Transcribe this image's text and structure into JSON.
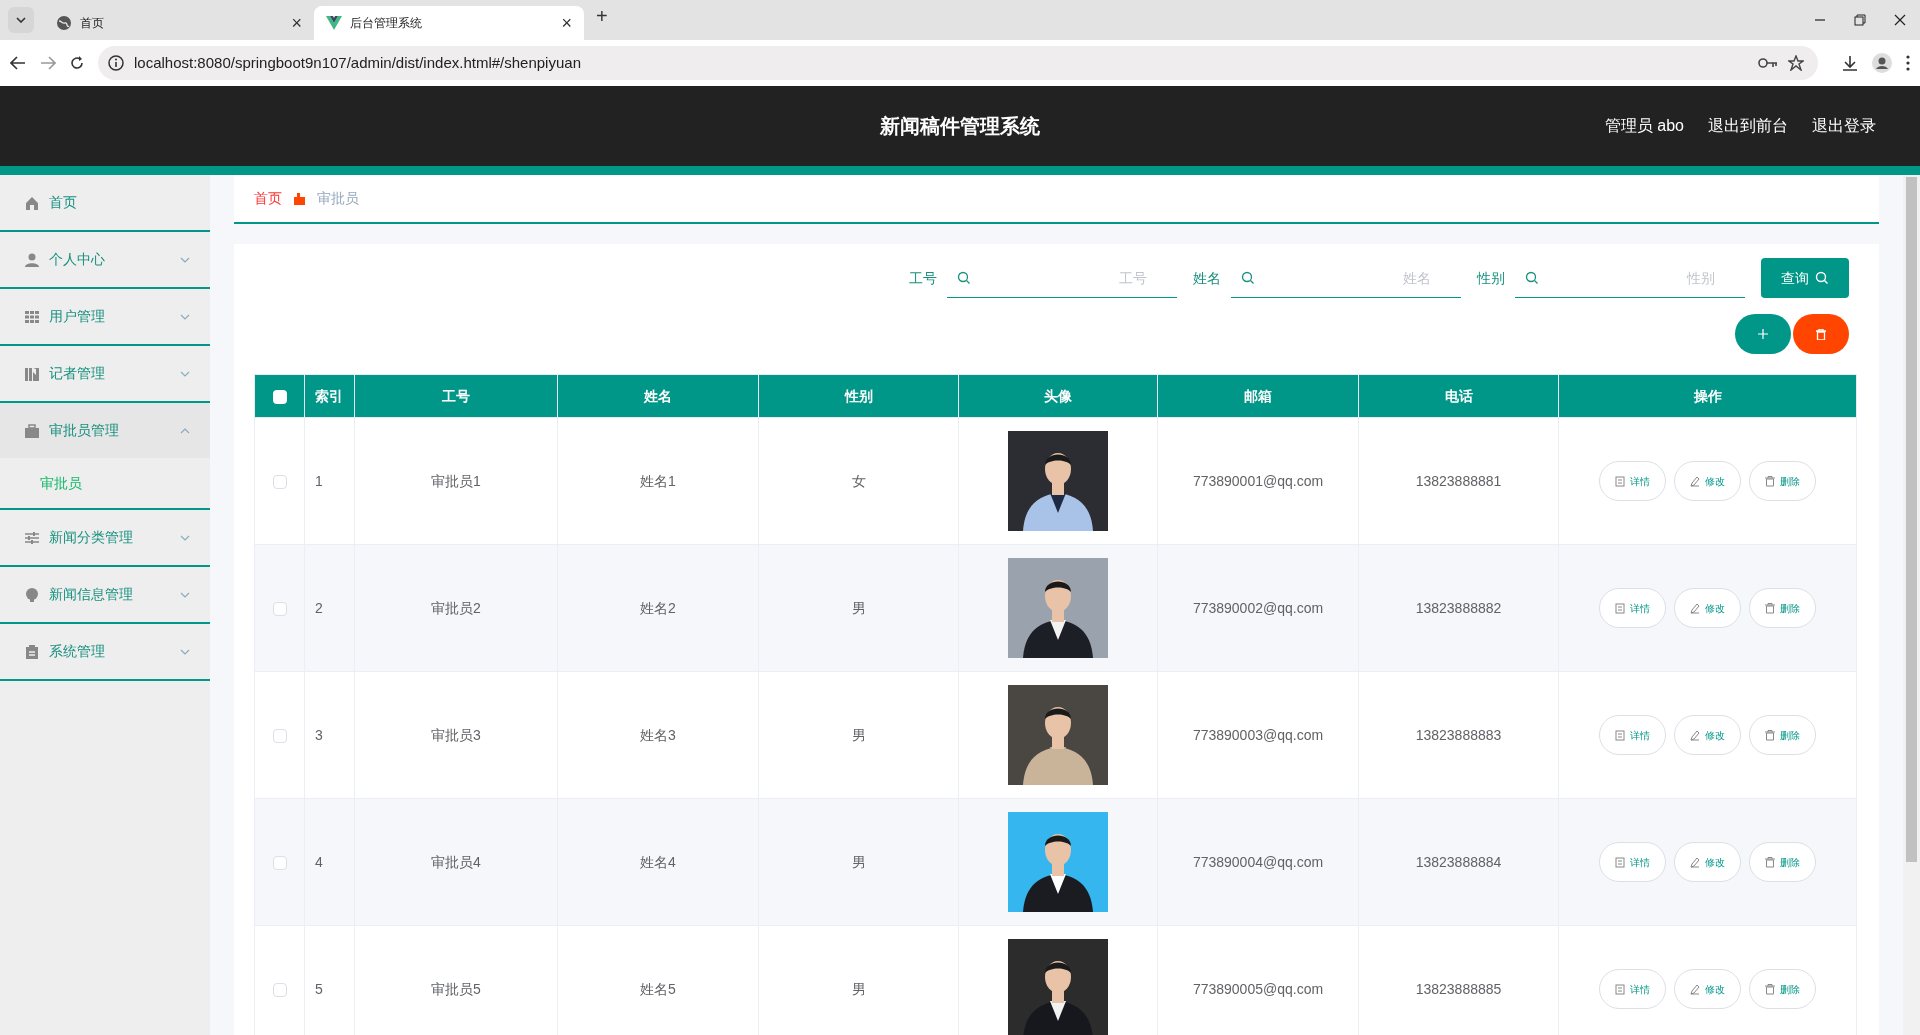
{
  "browser": {
    "tabs": [
      {
        "label": "首页",
        "selected": false,
        "close": "×"
      },
      {
        "label": "后台管理系统",
        "selected": true,
        "close": "×"
      }
    ],
    "new_tab": "+",
    "url": "localhost:8080/springboot9n107/admin/dist/index.html#/shenpiyuan"
  },
  "header": {
    "title": "新闻稿件管理系统",
    "links": [
      "管理员 abo",
      "退出到前台",
      "退出登录"
    ]
  },
  "sidebar": {
    "items": [
      {
        "label": "首页"
      },
      {
        "label": "个人中心",
        "expanded": false
      },
      {
        "label": "用户管理",
        "expanded": false
      },
      {
        "label": "记者管理",
        "expanded": false
      },
      {
        "label": "审批员管理",
        "expanded": true,
        "children": [
          {
            "label": "审批员",
            "selected": true
          }
        ]
      },
      {
        "label": "新闻分类管理",
        "expanded": false
      },
      {
        "label": "新闻信息管理",
        "expanded": false
      },
      {
        "label": "系统管理",
        "expanded": false
      }
    ]
  },
  "breadcrumb": [
    "首页",
    "审批员"
  ],
  "search": {
    "fields": [
      {
        "label": "工号",
        "placeholder": "工号"
      },
      {
        "label": "姓名",
        "placeholder": "姓名"
      },
      {
        "label": "性别",
        "placeholder": "性别"
      }
    ],
    "button": "查询"
  },
  "table": {
    "columns": [
      "索引",
      "工号",
      "姓名",
      "性别",
      "头像",
      "邮箱",
      "电话",
      "操作"
    ],
    "header_checked": false,
    "rows": [
      {
        "checked": false,
        "cells": [
          "1",
          "审批员1",
          "姓名1",
          "女",
          {
            "kind": "picture"
          },
          "773890001@qq.com",
          "13823888881",
          [
            "详情",
            "修改",
            "删除"
          ]
        ]
      },
      {
        "checked": false,
        "cells": [
          "2",
          "审批员2",
          "姓名2",
          "男",
          {
            "kind": "picture"
          },
          "773890002@qq.com",
          "13823888882",
          [
            "详情",
            "修改",
            "删除"
          ]
        ]
      },
      {
        "checked": false,
        "cells": [
          "3",
          "审批员3",
          "姓名3",
          "男",
          {
            "kind": "picture"
          },
          "773890003@qq.com",
          "13823888883",
          [
            "详情",
            "修改",
            "删除"
          ]
        ]
      },
      {
        "checked": false,
        "cells": [
          "4",
          "审批员4",
          "姓名4",
          "男",
          {
            "kind": "picture"
          },
          "773890004@qq.com",
          "13823888884",
          [
            "详情",
            "修改",
            "删除"
          ]
        ]
      },
      {
        "checked": false,
        "cells": [
          "5",
          "审批员5",
          "姓名5",
          "男",
          {
            "kind": "picture"
          },
          "773890005@qq.com",
          "13823888885",
          [
            "详情",
            "修改",
            "删除"
          ]
        ]
      }
    ]
  }
}
